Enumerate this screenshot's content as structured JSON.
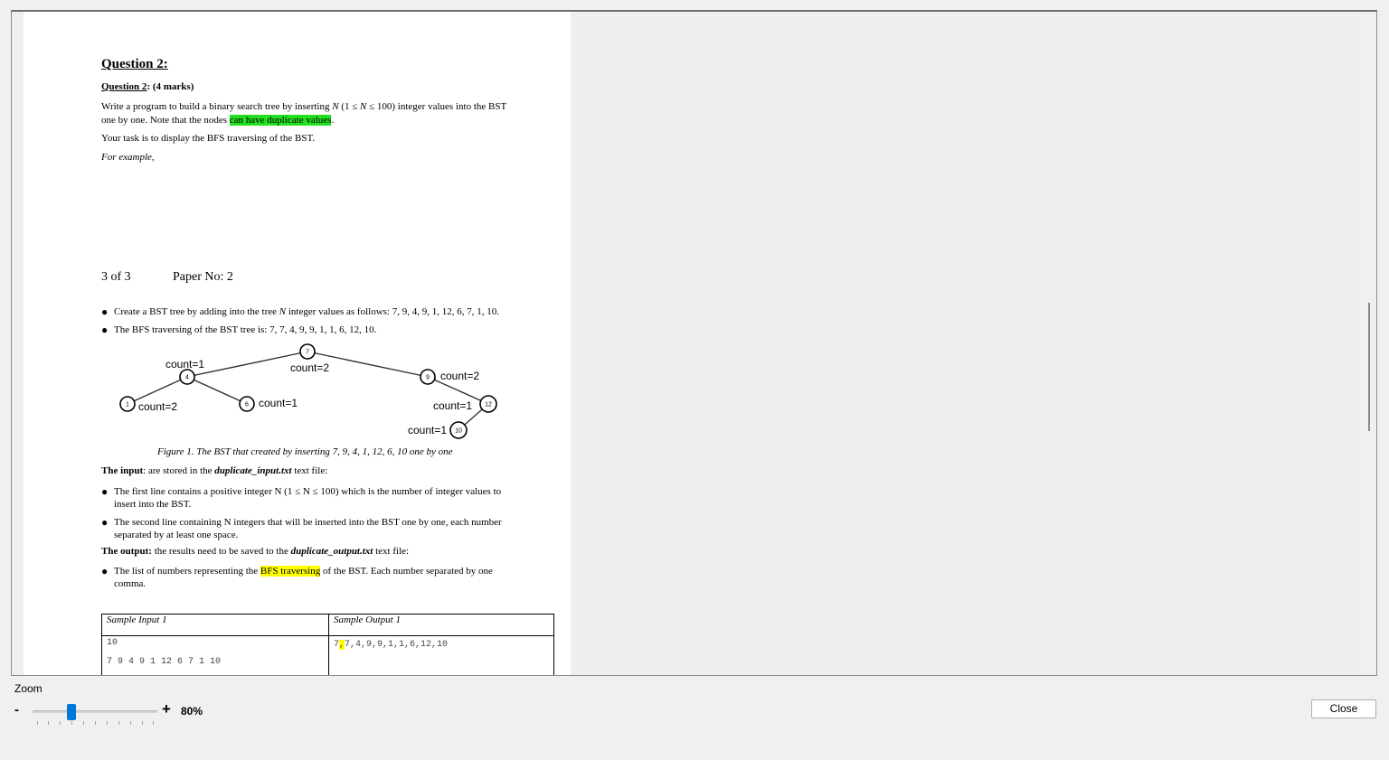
{
  "document": {
    "heading": "Question 2:",
    "subheading_label": "Question 2",
    "subheading_marks": ": (4 marks)",
    "para1_before": "Write a program to build a binary search tree by inserting ",
    "para1_n": "N",
    "para1_range_a": " (1 ≤ ",
    "para1_range_n": "N",
    "para1_range_b": " ≤ 100) integer values into the BST",
    "para1_line2_before": "one by one. Note that the nodes ",
    "para1_highlight": "can have duplicate values",
    "para1_end": ".",
    "para2": "Your task is to display the BFS traversing of the BST.",
    "para3": "For example,",
    "page_number": "3 of 3",
    "paper_no": "Paper No: 2",
    "bullet1_before": "Create a BST tree by adding into the tree ",
    "bullet1_n": "N",
    "bullet1_after": " integer values as follows: 7, 9, 4, 9, 1, 12, 6, 7, 1, 10.",
    "bullet2": "The BFS traversing of the BST tree is: 7, 7, 4, 9, 9, 1, 1, 6, 12, 10.",
    "figure_caption": "Figure 1. The BST that created by inserting 7, 9, 4, 1, 12, 6, 10 one by one",
    "input_label": "The input",
    "input_text_a": ": are stored in the ",
    "input_file": "duplicate_input.txt",
    "input_text_b": " text file:",
    "input_b1_line1": "The first line contains a positive integer N (1 ≤ N ≤ 100) which is the number of integer values to",
    "input_b1_line2": "insert into the BST.",
    "input_b2_line1": "The second line containing N integers that will be inserted into the BST one by one, each number",
    "input_b2_line2": "separated by at least one space.",
    "output_label": "The output:",
    "output_text_a": " the results need to be saved to the ",
    "output_file": "duplicate_output.txt",
    "output_text_b": " text file:",
    "output_b1_before": "The list of numbers representing the ",
    "output_b1_highlight": "BFS traversing",
    "output_b1_after": " of the BST. Each number separated by one",
    "output_b1_line2": "comma.",
    "table": {
      "col1_header": "Sample Input 1",
      "col2_header": "Sample Output 1",
      "input_line1": "10",
      "input_line2": "7 9 4 9 1 12 6 7 1 10",
      "output_first": "7",
      "output_comma": ",",
      "output_rest": "7,4,9,9,1,1,6,12,10"
    }
  },
  "tree": {
    "nodes": [
      {
        "value": "7",
        "count": "count=2"
      },
      {
        "value": "4",
        "count": "count=1"
      },
      {
        "value": "9",
        "count": "count=2"
      },
      {
        "value": "1",
        "count": "count=2"
      },
      {
        "value": "6",
        "count": "count=1"
      },
      {
        "value": "12",
        "count": "count=1"
      },
      {
        "value": "10",
        "count": "count=1"
      }
    ]
  },
  "controls": {
    "zoom_label": "Zoom",
    "zoom_minus": "-",
    "zoom_plus": "+",
    "zoom_value": "80%",
    "zoom_level_percent": 80,
    "close_label": "Close"
  },
  "colors": {
    "highlight_green": "#22e01f",
    "highlight_yellow": "#ffff00",
    "slider_accent": "#0078d7"
  }
}
